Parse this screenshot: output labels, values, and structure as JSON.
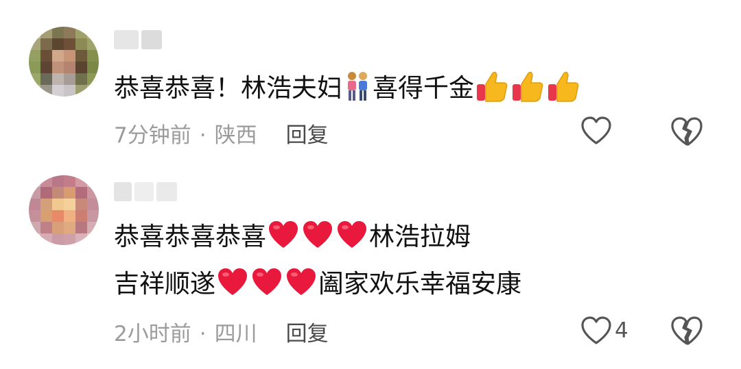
{
  "comments": [
    {
      "text_parts": [
        "恭喜恭喜！林浩夫妇",
        "喜得千金"
      ],
      "time": "7分钟前",
      "location": "陕西",
      "reply_label": "回复",
      "like_count": ""
    },
    {
      "line1_parts": [
        "恭喜恭喜恭喜",
        "林浩拉姆"
      ],
      "line2_parts": [
        "吉祥顺遂",
        "阖家欢乐幸福安康"
      ],
      "time": "2小时前",
      "location": "四川",
      "reply_label": "回复",
      "like_count": "4"
    }
  ],
  "separator": "·",
  "icons": {
    "like": "heart-outline-icon",
    "dislike": "broken-heart-icon",
    "emoji_couple": "couple-emoji",
    "emoji_thumb": "thumbs-up-emoji",
    "emoji_heart": "red-heart-emoji"
  },
  "colors": {
    "text": "#111111",
    "meta": "#9b9b9b",
    "heart": "#e8193c"
  }
}
